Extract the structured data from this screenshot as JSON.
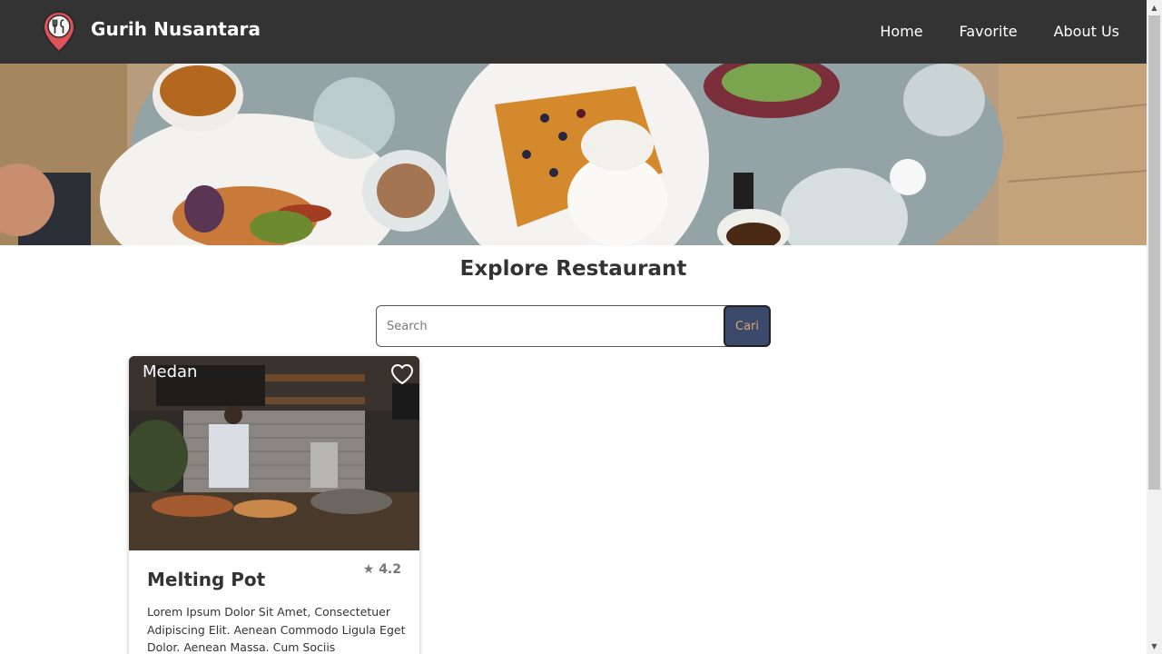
{
  "header": {
    "brand": "Gurih Nusantara",
    "nav": [
      {
        "label": "Home"
      },
      {
        "label": "Favorite"
      },
      {
        "label": "About Us"
      }
    ]
  },
  "main": {
    "title": "Explore Restaurant",
    "search": {
      "placeholder": "Search",
      "value": "",
      "button_label": "Cari"
    },
    "restaurants": [
      {
        "city": "Medan",
        "name": "Melting Pot",
        "rating": "4.2",
        "description": "Lorem Ipsum Dolor Sit Amet, Consectetuer Adipiscing Elit. Aenean Commodo Ligula Eget Dolor. Aenean Massa. Cum Sociis"
      }
    ]
  },
  "colors": {
    "header_bg": "#333333",
    "search_button_bg": "#3b4a6b",
    "search_button_text": "#d9a46f",
    "logo_pin": "#e0525a"
  },
  "icons": {
    "logo": "pin-fork-knife-icon",
    "favorite": "heart-outline-icon",
    "rating": "star-icon"
  }
}
